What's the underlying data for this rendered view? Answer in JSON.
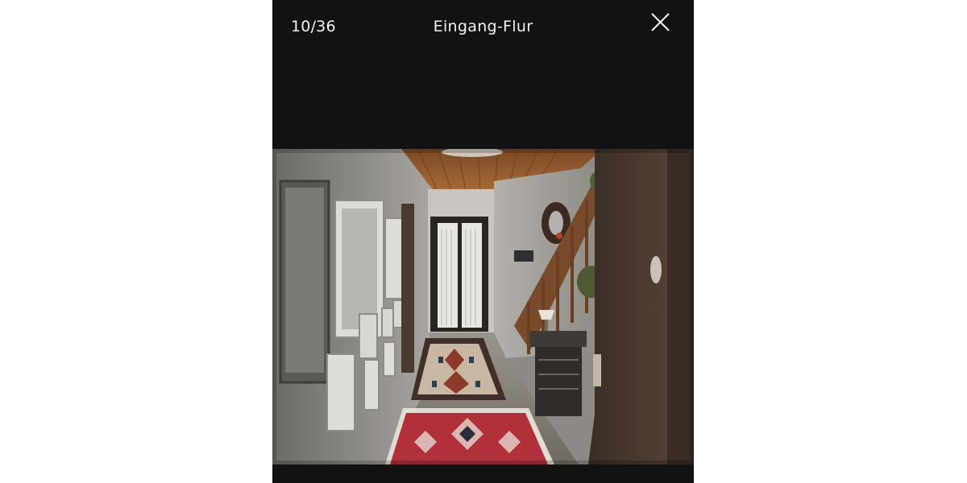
{
  "viewer": {
    "counter": "10/36",
    "title": "Eingang-Flur",
    "close_icon": "close-icon"
  },
  "colors": {
    "background": "#121212",
    "text": "#f2f2f2",
    "page": "#ffffff"
  }
}
